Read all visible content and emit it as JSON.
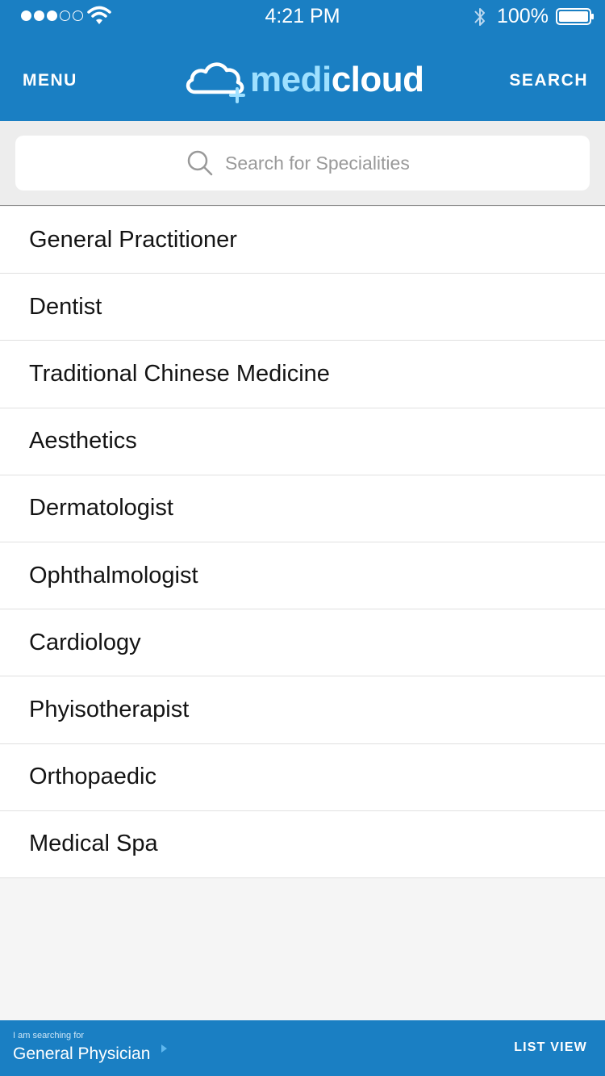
{
  "status_bar": {
    "time": "4:21 PM",
    "battery": "100%",
    "signal_icon": "signal-dots-icon",
    "wifi_icon": "wifi-icon",
    "bluetooth_icon": "bluetooth-icon",
    "battery_icon": "battery-icon"
  },
  "header": {
    "menu_label": "MENU",
    "search_label": "SEARCH",
    "logo": {
      "part1": "medi",
      "part2": "cloud",
      "icon": "cloud-plus-icon"
    },
    "color": "#1a7fc3"
  },
  "search": {
    "placeholder": "Search for Specialities",
    "icon": "search-icon"
  },
  "specialities": [
    "General Practitioner",
    "Dentist",
    "Traditional Chinese Medicine",
    "Aesthetics",
    "Dermatologist",
    "Ophthalmologist",
    "Cardiology",
    "Phyisotherapist",
    "Orthopaedic",
    "Medical Spa"
  ],
  "footer": {
    "label": "I am searching for",
    "value": "General Physician",
    "list_view": "LIST VIEW",
    "arrow_icon": "triangle-right-icon"
  }
}
